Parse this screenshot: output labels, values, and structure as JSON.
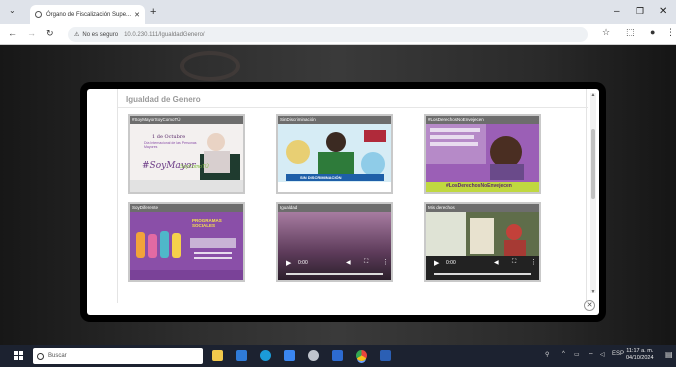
{
  "browser": {
    "tab_title": "Órgano de Fiscalización Supe...",
    "security_label": "No es seguro",
    "url": "10.0.230.111/IgualdadGenero/"
  },
  "modal": {
    "heading": "Igualdad de Genero",
    "cards": [
      {
        "caption": "#SoyMayorSoyComoTÚ",
        "poster_title": "1 de Octubre",
        "poster_subtitle": "Día Internacional de las Personas Mayores",
        "hashtag": "#SoyMayor",
        "hashtag2": "SoyComoTÚ"
      },
      {
        "caption": "SinDiscriminación",
        "banner": "SIN DISCRIMINACIÓN"
      },
      {
        "caption": "#LosDerechosNoEnvejecen",
        "hashtag": "#LosDerechosNoEnvejecen"
      },
      {
        "caption": "SoyDiferente",
        "poster_title": "PROGRAMAS SOCIALES"
      },
      {
        "caption": "Igualdad",
        "time": "0:00"
      },
      {
        "caption": "Mis derechos",
        "time": "0:00"
      }
    ]
  },
  "taskbar": {
    "search_placeholder": "Buscar",
    "lang": "ESP",
    "time": "11:17 a. m.",
    "date": "04/10/2024"
  },
  "colors": {
    "accent_purple": "#8a4fa8",
    "caption_gray": "#6d6d6d",
    "taskbar": "#1c2230"
  }
}
